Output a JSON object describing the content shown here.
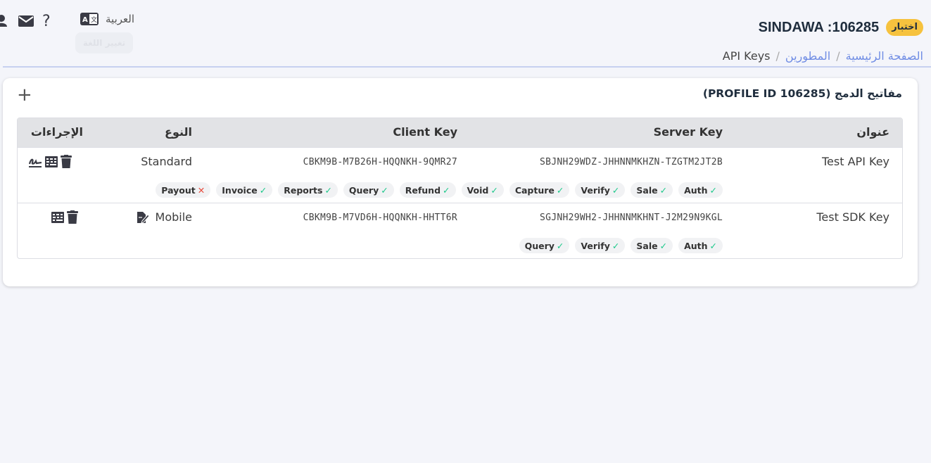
{
  "header": {
    "language_label": "العربية",
    "language_tooltip": "تغيير اللغة",
    "help_label": "?",
    "badge": "اختبار",
    "account_title": "SINDAWA :106285"
  },
  "breadcrumb": {
    "home": "الصفحة الرئيسية",
    "developers": "المطورين",
    "current": "API Keys",
    "separator": "/"
  },
  "card": {
    "title": "مفاتيح الدمج (PROFILE ID 106285)",
    "add_label": "+"
  },
  "table": {
    "headers": {
      "title": "عنوان",
      "server_key": "Server Key",
      "client_key": "Client Key",
      "type": "النوع",
      "actions": "الإجراءات"
    },
    "rows": [
      {
        "title": "Test API Key",
        "server_key": "SBJNH29WDZ-JHHNNMKHZN-TZGTM2JT2B",
        "client_key": "CBKM9B-M7B26H-HQQNKH-9QMR27",
        "type": "Standard",
        "permissions": [
          {
            "label": "Auth",
            "enabled": "✓"
          },
          {
            "label": "Sale",
            "enabled": "✓"
          },
          {
            "label": "Verify",
            "enabled": "✓"
          },
          {
            "label": "Capture",
            "enabled": "✓"
          },
          {
            "label": "Void",
            "enabled": "✓"
          },
          {
            "label": "Refund",
            "enabled": "✓"
          },
          {
            "label": "Query",
            "enabled": "✓"
          },
          {
            "label": "Reports",
            "enabled": "✓"
          },
          {
            "label": "Invoice",
            "enabled": "✓"
          },
          {
            "label": "Payout",
            "enabled": "✕"
          }
        ]
      },
      {
        "title": "Test SDK Key",
        "server_key": "SGJNH29WH2-JHHNNMKHNT-J2M29N9KGL",
        "client_key": "CBKM9B-M7VD6H-HQQNKH-HHTT6R",
        "type": "Mobile",
        "permissions": [
          {
            "label": "Auth",
            "enabled": "✓"
          },
          {
            "label": "Sale",
            "enabled": "✓"
          },
          {
            "label": "Verify",
            "enabled": "✓"
          },
          {
            "label": "Query",
            "enabled": "✓"
          }
        ]
      }
    ]
  },
  "colors": {
    "accent": "#4e73df",
    "badge": "#f6c23e",
    "success": "#1cc88a",
    "danger": "#e74a3b"
  }
}
